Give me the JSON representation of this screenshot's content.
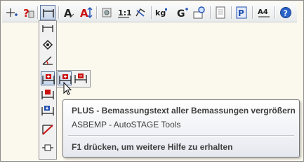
{
  "toolbar": {
    "items": [
      {
        "icon": "crosshair-plus-icon"
      },
      {
        "icon": "help-object-icon"
      },
      {
        "icon": "dimension-flyout-icon",
        "selected": true
      },
      {
        "icon": "text-style-icon"
      },
      {
        "icon": "text-height-icon"
      },
      {
        "icon": "tools-icon"
      },
      {
        "icon": "scale-icon",
        "text": "1:1"
      },
      {
        "icon": "rotate-icon"
      },
      {
        "icon": "weight-icon",
        "text": "kg"
      },
      {
        "icon": "goto-icon",
        "text": "G"
      },
      {
        "icon": "zoom-window-icon"
      },
      {
        "icon": "page-icon"
      },
      {
        "icon": "plot-icon",
        "text": "P"
      },
      {
        "icon": "paper-a4-icon",
        "text": "A4"
      },
      {
        "icon": "help-icon",
        "text": "?"
      }
    ]
  },
  "flyout": {
    "items": [
      {
        "icon": "linear-dimension-icon"
      },
      {
        "icon": "angle-arrow-icon"
      },
      {
        "icon": "angular-dimension-icon"
      },
      {
        "icon": "dimension-text-size-icon",
        "selected": true
      },
      {
        "icon": "dimension-text-move-icon"
      },
      {
        "icon": "dimension-text-shift-icon"
      },
      {
        "icon": "dimension-delete-icon"
      },
      {
        "icon": "dimension-frame-icon"
      }
    ]
  },
  "subflyout": {
    "items": [
      {
        "icon": "dimension-text-plus-icon",
        "hover": true
      },
      {
        "icon": "dimension-text-minus-icon"
      }
    ]
  },
  "tooltip": {
    "title": "PLUS - Bemassungstext aller Bemassungen vergrößern",
    "description": "ASBEMP - AutoSTAGE Tools",
    "help": "F1 drücken, um weitere Hilfe zu erhalten"
  },
  "colors": {
    "background": "#fbf8ee",
    "accent_red": "#cc1111",
    "accent_blue": "#1f4fb0",
    "selection_border": "#59739a"
  }
}
